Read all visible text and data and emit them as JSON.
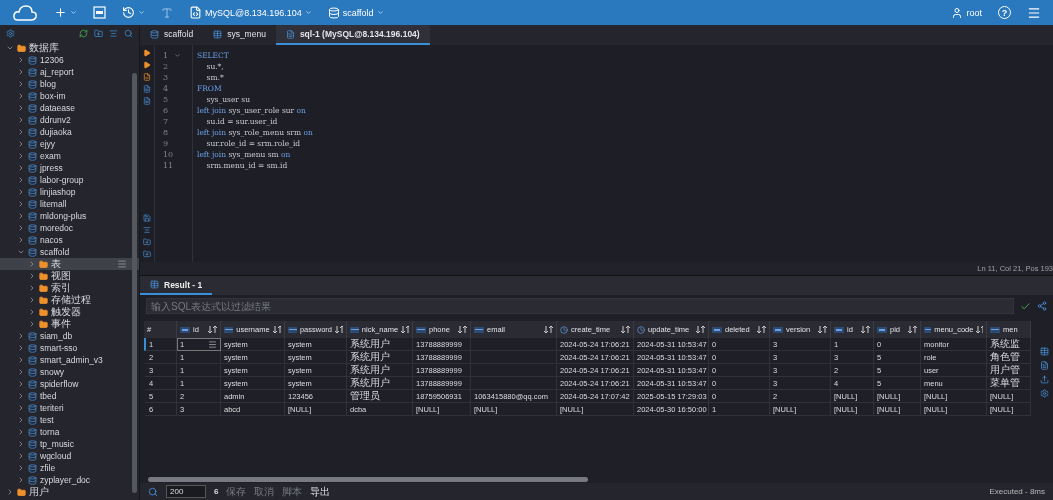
{
  "topbar": {
    "connection": "MySQL@8.134.196.104",
    "database": "scaffold",
    "user": "root",
    "help": "?"
  },
  "tree": [
    {
      "label": "数据库",
      "kind": "folder",
      "expanded": true,
      "selected": false,
      "children": [
        {
          "label": "12306",
          "kind": "db",
          "expanded": false,
          "selected": false
        },
        {
          "label": "aj_report",
          "kind": "db",
          "expanded": false,
          "selected": false
        },
        {
          "label": "blog",
          "kind": "db",
          "expanded": false,
          "selected": false
        },
        {
          "label": "box-im",
          "kind": "db",
          "expanded": false,
          "selected": false
        },
        {
          "label": "dataease",
          "kind": "db",
          "expanded": false,
          "selected": false
        },
        {
          "label": "ddrunv2",
          "kind": "db",
          "expanded": false,
          "selected": false
        },
        {
          "label": "dujiaoka",
          "kind": "db",
          "expanded": false,
          "selected": false
        },
        {
          "label": "ejyy",
          "kind": "db",
          "expanded": false,
          "selected": false
        },
        {
          "label": "exam",
          "kind": "db",
          "expanded": false,
          "selected": false
        },
        {
          "label": "jpress",
          "kind": "db",
          "expanded": false,
          "selected": false
        },
        {
          "label": "labor-group",
          "kind": "db",
          "expanded": false,
          "selected": false
        },
        {
          "label": "linjiashop",
          "kind": "db",
          "expanded": false,
          "selected": false
        },
        {
          "label": "litemall",
          "kind": "db",
          "expanded": false,
          "selected": false
        },
        {
          "label": "mldong-plus",
          "kind": "db",
          "expanded": false,
          "selected": false
        },
        {
          "label": "moredoc",
          "kind": "db",
          "expanded": false,
          "selected": false
        },
        {
          "label": "nacos",
          "kind": "db",
          "expanded": false,
          "selected": false
        },
        {
          "label": "scaffold",
          "kind": "db",
          "expanded": true,
          "selected": false,
          "children": [
            {
              "label": "表",
              "kind": "folder",
              "expanded": false,
              "selected": true
            },
            {
              "label": "视图",
              "kind": "folder",
              "expanded": false,
              "selected": false
            },
            {
              "label": "索引",
              "kind": "folder",
              "expanded": false,
              "selected": false
            },
            {
              "label": "存储过程",
              "kind": "folder",
              "expanded": false,
              "selected": false
            },
            {
              "label": "触发器",
              "kind": "folder",
              "expanded": false,
              "selected": false
            },
            {
              "label": "事件",
              "kind": "folder",
              "expanded": false,
              "selected": false
            }
          ]
        },
        {
          "label": "siam_db",
          "kind": "db",
          "expanded": false,
          "selected": false
        },
        {
          "label": "smart-sso",
          "kind": "db",
          "expanded": false,
          "selected": false
        },
        {
          "label": "smart_admin_v3",
          "kind": "db",
          "expanded": false,
          "selected": false
        },
        {
          "label": "snowy",
          "kind": "db",
          "expanded": false,
          "selected": false
        },
        {
          "label": "spiderflow",
          "kind": "db",
          "expanded": false,
          "selected": false
        },
        {
          "label": "tbed",
          "kind": "db",
          "expanded": false,
          "selected": false
        },
        {
          "label": "teriteri",
          "kind": "db",
          "expanded": false,
          "selected": false
        },
        {
          "label": "test",
          "kind": "db",
          "expanded": false,
          "selected": false
        },
        {
          "label": "torna",
          "kind": "db",
          "expanded": false,
          "selected": false
        },
        {
          "label": "tp_music",
          "kind": "db",
          "expanded": false,
          "selected": false
        },
        {
          "label": "wgcloud",
          "kind": "db",
          "expanded": false,
          "selected": false
        },
        {
          "label": "zfile",
          "kind": "db",
          "expanded": false,
          "selected": false
        },
        {
          "label": "zyplayer_doc",
          "kind": "db",
          "expanded": false,
          "selected": false
        }
      ]
    },
    {
      "label": "用户",
      "kind": "folder",
      "expanded": false,
      "selected": false
    }
  ],
  "tabs": [
    {
      "label": "scaffold",
      "kind": "db",
      "selected": false
    },
    {
      "label": "sys_menu",
      "kind": "table",
      "selected": false
    },
    {
      "label": "sql-1 (MySQL@8.134.196.104)",
      "kind": "sql",
      "selected": true
    }
  ],
  "editor": {
    "lines": [
      {
        "number": "1",
        "tokens": [
          {
            "kind": "keyword",
            "text": "SELECT"
          }
        ]
      },
      {
        "number": "2",
        "tokens": [
          {
            "kind": "plain",
            "text": "    su.*,"
          }
        ]
      },
      {
        "number": "3",
        "tokens": [
          {
            "kind": "plain",
            "text": "    sm.*"
          }
        ]
      },
      {
        "number": "4",
        "tokens": [
          {
            "kind": "keyword",
            "text": "FROM"
          }
        ]
      },
      {
        "number": "5",
        "tokens": [
          {
            "kind": "plain",
            "text": "    sys_user su"
          }
        ]
      },
      {
        "number": "6",
        "tokens": [
          {
            "kind": "keyword",
            "text": "left join"
          },
          {
            "kind": "plain",
            "text": " sys_user_role sur "
          },
          {
            "kind": "keyword",
            "text": "on"
          }
        ]
      },
      {
        "number": "7",
        "tokens": [
          {
            "kind": "plain",
            "text": "    su.id = sur.user_id"
          }
        ]
      },
      {
        "number": "8",
        "tokens": [
          {
            "kind": "keyword",
            "text": "left join"
          },
          {
            "kind": "plain",
            "text": " sys_role_menu srm "
          },
          {
            "kind": "keyword",
            "text": "on"
          }
        ]
      },
      {
        "number": "9",
        "tokens": [
          {
            "kind": "plain",
            "text": "    sur.role_id = srm.role_id"
          }
        ]
      },
      {
        "number": "10",
        "tokens": [
          {
            "kind": "keyword",
            "text": "left join"
          },
          {
            "kind": "plain",
            "text": " sys_menu sm "
          },
          {
            "kind": "keyword",
            "text": "on"
          }
        ]
      },
      {
        "number": "11",
        "tokens": [
          {
            "kind": "plain",
            "text": "    srm.menu_id = sm.id"
          }
        ]
      }
    ],
    "position": "Ln 11, Col 21, Pos 193"
  },
  "result": {
    "tab": "Result - 1",
    "filter_placeholder": "输入SQL表达式以过滤结果",
    "columns": [
      {
        "name": "#",
        "kind": "index"
      },
      {
        "name": "id",
        "kind": "number"
      },
      {
        "name": "username",
        "kind": "text"
      },
      {
        "name": "password",
        "kind": "text"
      },
      {
        "name": "nick_name",
        "kind": "text"
      },
      {
        "name": "phone",
        "kind": "text"
      },
      {
        "name": "email",
        "kind": "text"
      },
      {
        "name": "create_time",
        "kind": "time"
      },
      {
        "name": "update_time",
        "kind": "time"
      },
      {
        "name": "deleted",
        "kind": "number"
      },
      {
        "name": "version",
        "kind": "number"
      },
      {
        "name": "id",
        "kind": "number"
      },
      {
        "name": "pid",
        "kind": "number"
      },
      {
        "name": "menu_code",
        "kind": "text"
      },
      {
        "name": "men",
        "kind": "text"
      }
    ],
    "rows": [
      {
        "selected": true,
        "cells": [
          "1",
          "1",
          "system",
          "system",
          "系统用户",
          "13788889999",
          "",
          "2024-05-24 17:06:21",
          "2024-05-31 10:53:47",
          "0",
          "3",
          "1",
          "0",
          "monitor",
          "系统监"
        ]
      },
      {
        "selected": false,
        "cells": [
          "2",
          "1",
          "system",
          "system",
          "系统用户",
          "13788889999",
          "",
          "2024-05-24 17:06:21",
          "2024-05-31 10:53:47",
          "0",
          "3",
          "3",
          "5",
          "role",
          "角色管"
        ]
      },
      {
        "selected": false,
        "cells": [
          "3",
          "1",
          "system",
          "system",
          "系统用户",
          "13788889999",
          "",
          "2024-05-24 17:06:21",
          "2024-05-31 10:53:47",
          "0",
          "3",
          "2",
          "5",
          "user",
          "用户管"
        ]
      },
      {
        "selected": false,
        "cells": [
          "4",
          "1",
          "system",
          "system",
          "系统用户",
          "13788889999",
          "",
          "2024-05-24 17:06:21",
          "2024-05-31 10:53:47",
          "0",
          "3",
          "4",
          "5",
          "menu",
          "菜单管"
        ]
      },
      {
        "selected": false,
        "cells": [
          "5",
          "2",
          "admin",
          "123456",
          "管理员",
          "18759506931",
          "1063415880@qq.com",
          "2024-05-24 17:07:42",
          "2025-05-15 17:29:03",
          "0",
          "2",
          "[NULL]",
          "[NULL]",
          "[NULL]",
          "[NULL]"
        ]
      },
      {
        "selected": false,
        "cells": [
          "6",
          "3",
          "abcd",
          "[NULL]",
          "dcba",
          "[NULL]",
          "[NULL]",
          "[NULL]",
          "2024-05-30 16:50:00",
          "1",
          "[NULL]",
          "[NULL]",
          "[NULL]",
          "[NULL]",
          "[NULL]"
        ]
      }
    ]
  },
  "bottombar": {
    "limit": "200",
    "row_count": "6",
    "actions": [
      {
        "label": "保存",
        "disabled": true
      },
      {
        "label": "取消",
        "disabled": true
      },
      {
        "label": "脚本",
        "disabled": true
      },
      {
        "label": "导出",
        "disabled": false
      }
    ],
    "status": "Executed - 8ms"
  }
}
